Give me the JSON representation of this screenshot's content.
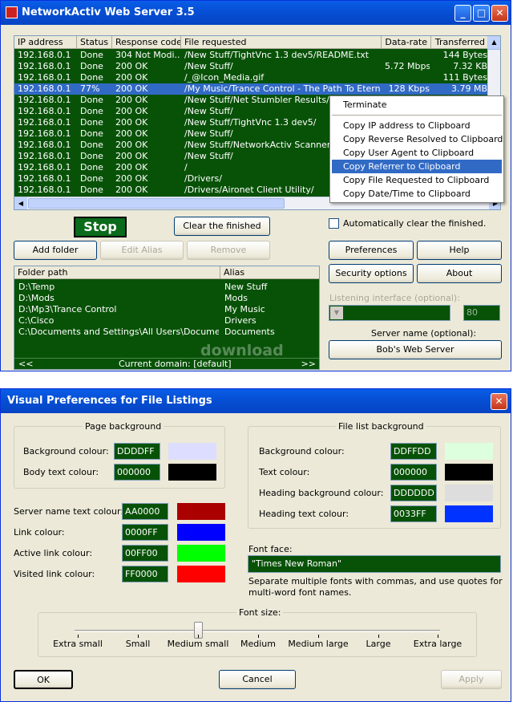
{
  "main_window": {
    "title": "NetworkActiv Web Server 3.5",
    "title_buttons": {
      "minimize": "_",
      "maximize": "□",
      "close": "✕"
    },
    "transfers": {
      "columns": [
        "IP address",
        "Status",
        "Response code",
        "File requested",
        "Data-rate",
        "Transferred"
      ],
      "rows": [
        [
          "192.168.0.1",
          "Done",
          "304 Not Modi...",
          "/New Stuff/TightVnc 1.3 dev5/README.txt",
          "",
          "144 Bytes"
        ],
        [
          "192.168.0.1",
          "Done",
          "200 OK",
          "/New Stuff/",
          "5.72 Mbps",
          "7.32 KB"
        ],
        [
          "192.168.0.1",
          "Done",
          "200 OK",
          "/_@Icon_Media.gif",
          "",
          "111 Bytes"
        ],
        [
          "192.168.0.1",
          "77%",
          "200 OK",
          "/My Music/Trance Control - The Path To Eternit...",
          "128 Kbps",
          "3.79 MB"
        ],
        [
          "192.168.0.1",
          "Done",
          "200 OK",
          "/New Stuff/Net Stumbler Results/",
          "",
          ""
        ],
        [
          "192.168.0.1",
          "Done",
          "200 OK",
          "/New Stuff/",
          "",
          ""
        ],
        [
          "192.168.0.1",
          "Done",
          "200 OK",
          "/New Stuff/TightVnc 1.3 dev5/",
          "",
          ""
        ],
        [
          "192.168.0.1",
          "Done",
          "200 OK",
          "/New Stuff/",
          "",
          ""
        ],
        [
          "192.168.0.1",
          "Done",
          "200 OK",
          "/New Stuff/NetworkActiv Scanner/",
          "",
          ""
        ],
        [
          "192.168.0.1",
          "Done",
          "200 OK",
          "/New Stuff/",
          "",
          ""
        ],
        [
          "192.168.0.1",
          "Done",
          "200 OK",
          "/",
          "",
          ""
        ],
        [
          "192.168.0.1",
          "Done",
          "200 OK",
          "/Drivers/",
          "",
          ""
        ],
        [
          "192.168.0.1",
          "Done",
          "200 OK",
          "/Drivers/Aironet Client Utility/",
          "",
          ""
        ]
      ]
    },
    "context_menu": [
      "Terminate",
      "Copy IP address to Clipboard",
      "Copy Reverse Resolved to Clipboard",
      "Copy User Agent to Clipboard",
      "Copy Referrer to Clipboard",
      "Copy File Requested to Clipboard",
      "Copy Date/Time to Clipboard"
    ],
    "stop_label": "Stop",
    "clear_finished_label": "Clear the finished",
    "auto_clear_label": "Automatically clear the finished.",
    "add_folder_label": "Add folder",
    "edit_alias_label": "Edit Alias",
    "remove_label": "Remove",
    "preferences_label": "Preferences",
    "help_label": "Help",
    "security_label": "Security options",
    "about_label": "About",
    "folders": {
      "columns": [
        "Folder path",
        "Alias"
      ],
      "rows": [
        [
          "D:\\Temp",
          "New Stuff"
        ],
        [
          "D:\\Mods",
          "Mods"
        ],
        [
          "D:\\Mp3\\Trance Control",
          "My Music"
        ],
        [
          "C:\\Cisco",
          "Drivers"
        ],
        [
          "C:\\Documents and Settings\\All Users\\Documents",
          "Documents"
        ]
      ],
      "footer_prev": "<<",
      "footer_domain": "Current domain: [default]",
      "footer_next": ">>"
    },
    "listening_label": "Listening interface (optional):",
    "port_value": "80",
    "server_name_label": "Server name (optional):",
    "server_name_value": "Bob's Web Server",
    "watermark": "download"
  },
  "prefs_window": {
    "title": "Visual Preferences for File Listings",
    "page_background_group": "Page background",
    "file_list_group": "File list background",
    "page_fields": [
      {
        "label": "Background colour:",
        "value": "DDDDFF",
        "color": "#DDDDFF"
      },
      {
        "label": "Body text colour:",
        "value": "000000",
        "color": "#000000"
      }
    ],
    "file_fields": [
      {
        "label": "Background colour:",
        "value": "DDFFDD",
        "color": "#DDFFDD"
      },
      {
        "label": "Text colour:",
        "value": "000000",
        "color": "#000000"
      },
      {
        "label": "Heading background colour:",
        "value": "DDDDDD",
        "color": "#DDDDDD"
      },
      {
        "label": "Heading text colour:",
        "value": "0033FF",
        "color": "#0033FF"
      }
    ],
    "link_fields": [
      {
        "label": "Server name text colour:",
        "value": "AA0000",
        "color": "#AA0000"
      },
      {
        "label": "Link colour:",
        "value": "0000FF",
        "color": "#0000FF"
      },
      {
        "label": "Active link colour:",
        "value": "00FF00",
        "color": "#00FF00"
      },
      {
        "label": "Visited link colour:",
        "value": "FF0000",
        "color": "#FF0000"
      }
    ],
    "font_face_label": "Font face:",
    "font_face_value": "\"Times New Roman\"",
    "font_hint": "Separate multiple fonts with commas, and use quotes for multi-word font names.",
    "font_size_group": "Font size:",
    "font_sizes": [
      "Extra small",
      "Small",
      "Medium small",
      "Medium",
      "Medium large",
      "Large",
      "Extra large"
    ],
    "font_size_selected_index": 2,
    "ok_label": "OK",
    "cancel_label": "Cancel",
    "apply_label": "Apply"
  }
}
